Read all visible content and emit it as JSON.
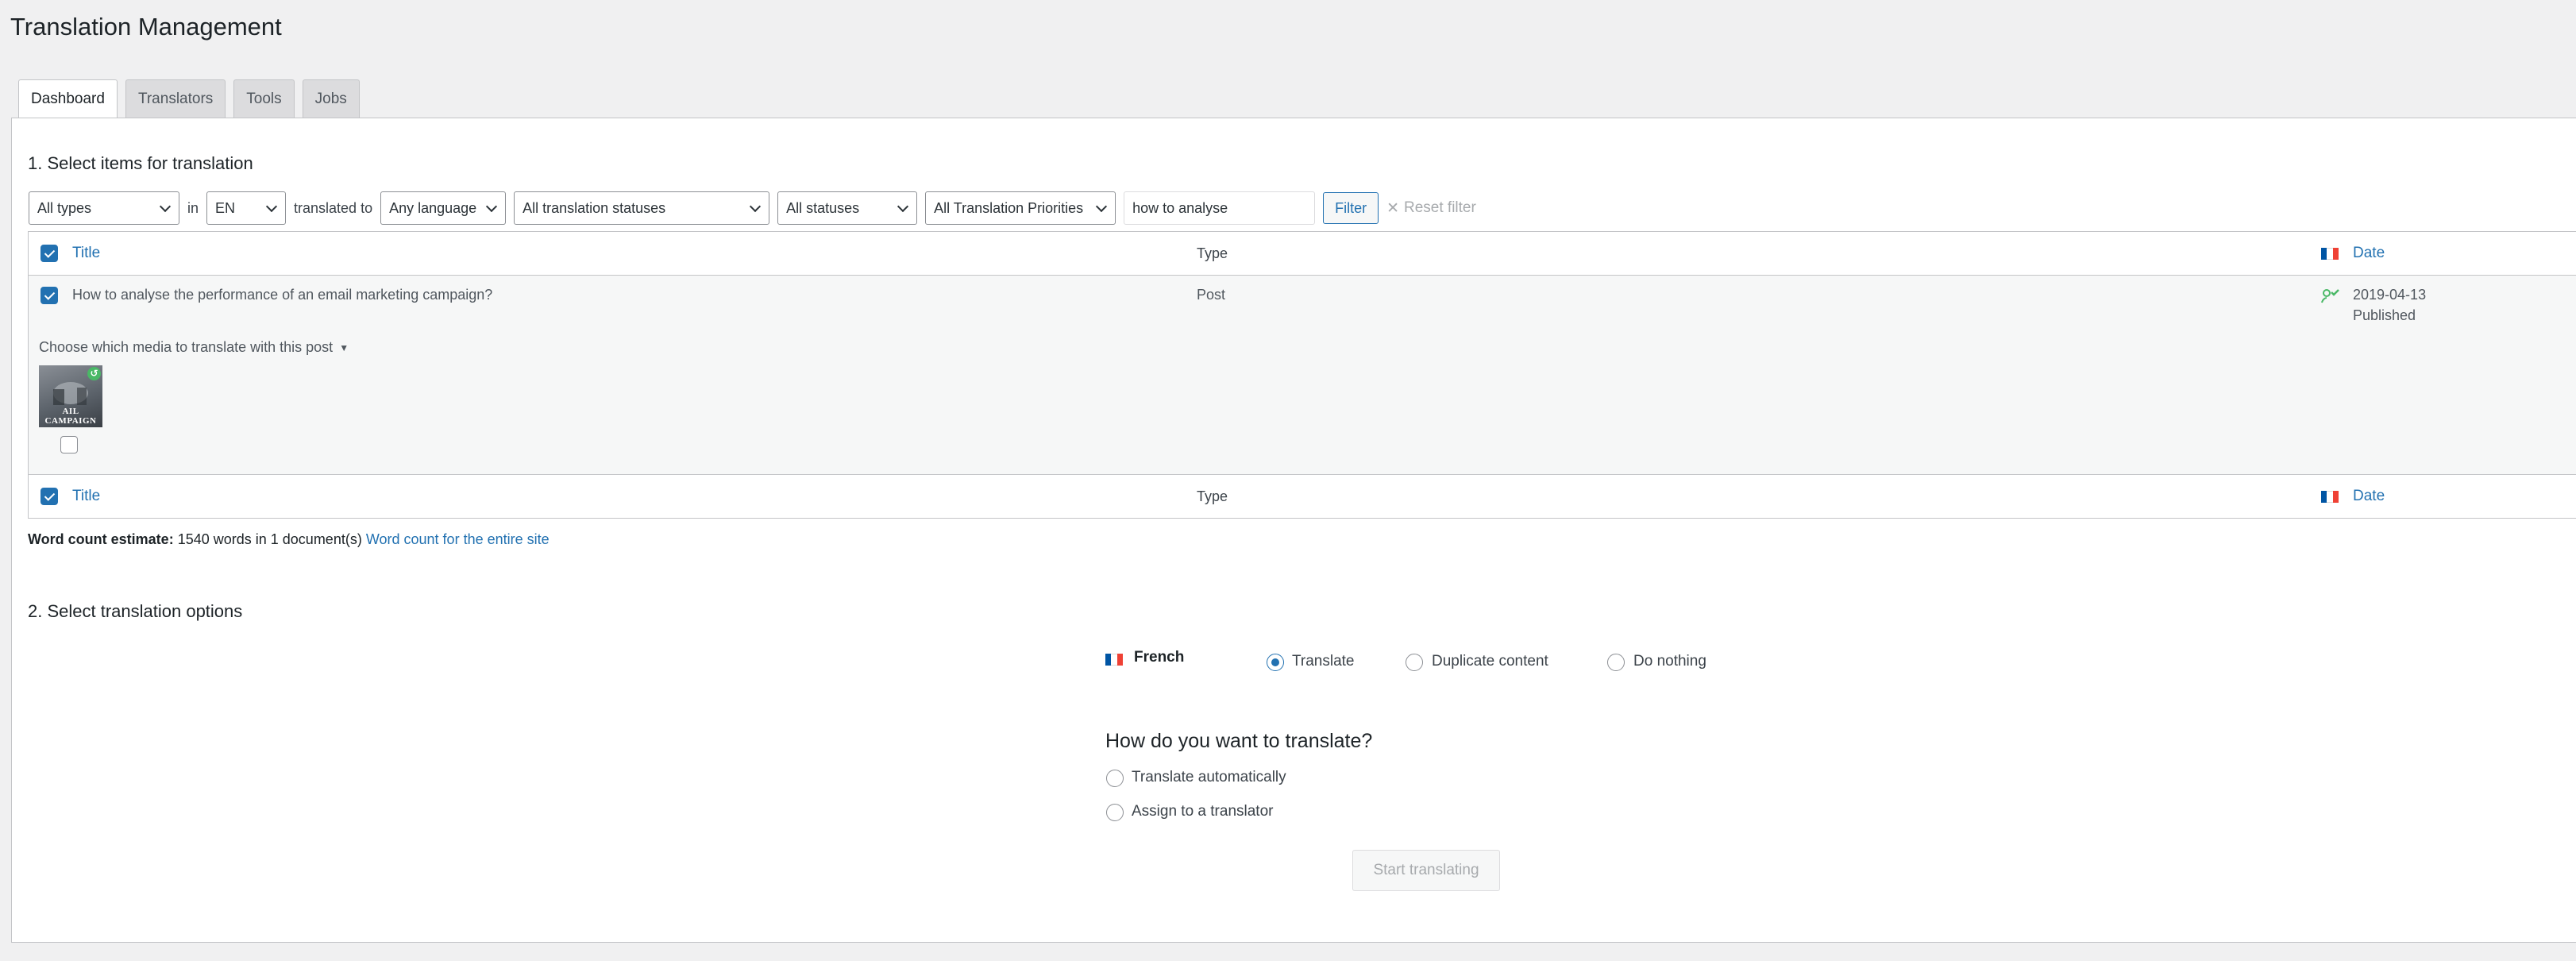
{
  "page": {
    "title": "Translation Management"
  },
  "tabs": [
    {
      "label": "Dashboard",
      "active": true
    },
    {
      "label": "Translators",
      "active": false
    },
    {
      "label": "Tools",
      "active": false
    },
    {
      "label": "Jobs",
      "active": false
    }
  ],
  "section1": {
    "title": "1. Select items for translation"
  },
  "filters": {
    "type_select": "All types",
    "in_label": "in",
    "language_select": "EN",
    "translated_to_label": "translated to",
    "target_language_select": "Any language",
    "translation_status_select": "All translation statuses",
    "status_select": "All statuses",
    "priority_select": "All Translation Priorities",
    "search_value": "how to analyse",
    "filter_button": "Filter",
    "reset_label": "Reset filter"
  },
  "table": {
    "columns": {
      "title": "Title",
      "type": "Type",
      "date": "Date"
    },
    "rows": [
      {
        "title": "How to analyse the performance of an email marketing campaign?",
        "type": "Post",
        "date": "2019-04-13",
        "status": "Published",
        "checked": true
      }
    ],
    "media_toggle": "Choose which media to translate with this post",
    "media_caption": "AIL CAMPAIGN"
  },
  "word_count": {
    "label": "Word count estimate:",
    "value": "1540 words in 1 document(s)",
    "link": "Word count for the entire site"
  },
  "section2": {
    "title": "2. Select translation options"
  },
  "options": {
    "language": "French",
    "choices": [
      "Translate",
      "Duplicate content",
      "Do nothing"
    ],
    "selected": "Translate",
    "how_title": "How do you want to translate?",
    "methods": [
      "Translate automatically",
      "Assign to a translator"
    ],
    "start_button": "Start translating"
  },
  "colors": {
    "accent": "#2271b1",
    "disabled": "#a7aaad",
    "flag_blue": "#0055a4",
    "flag_red": "#ef4135"
  }
}
